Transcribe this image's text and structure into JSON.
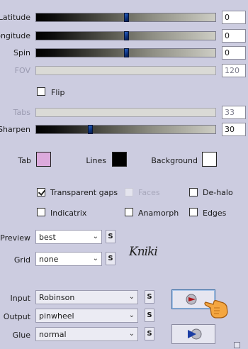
{
  "sliders": {
    "latitude": {
      "label": "Latitude",
      "value": "0",
      "level": 0.5
    },
    "longitude": {
      "label": "Longitude",
      "value": "0",
      "level": 0.5
    },
    "spin": {
      "label": "Spin",
      "value": "0",
      "level": 0.5
    },
    "fov": {
      "label": "FOV",
      "value": "120",
      "disabled": true
    },
    "tabs": {
      "label": "Tabs",
      "value": "33",
      "disabled": true
    },
    "sharpen": {
      "label": "Sharpen",
      "value": "30",
      "level": 0.3
    }
  },
  "flip": {
    "label": "Flip",
    "checked": false
  },
  "colors": {
    "tab": {
      "label": "Tab",
      "color": "#dcaadc"
    },
    "lines": {
      "label": "Lines",
      "color": "#000000"
    },
    "background": {
      "label": "Background",
      "color": "#ffffff"
    }
  },
  "checkboxes": {
    "transparent_gaps": {
      "label": "Transparent gaps",
      "checked": true
    },
    "faces": {
      "label": "Faces",
      "checked": false,
      "disabled": true
    },
    "de_halo": {
      "label": "De-halo",
      "checked": false
    },
    "indicatrix": {
      "label": "Indicatrix",
      "checked": false
    },
    "anamorph": {
      "label": "Anamorph",
      "checked": false
    },
    "edges": {
      "label": "Edges",
      "checked": false
    }
  },
  "selects": {
    "preview": {
      "label": "Preview",
      "value": "best"
    },
    "grid": {
      "label": "Grid",
      "value": "none"
    },
    "input": {
      "label": "Input",
      "value": "Robinson"
    },
    "output": {
      "label": "Output",
      "value": "pinwheel"
    },
    "glue": {
      "label": "Glue",
      "value": "normal"
    }
  },
  "s_button_label": "S",
  "signature": "Kniki",
  "icons": {
    "render": "play-ball-icon",
    "next": "play-forward-ball-icon",
    "cursor": "pointing-hand-icon"
  }
}
